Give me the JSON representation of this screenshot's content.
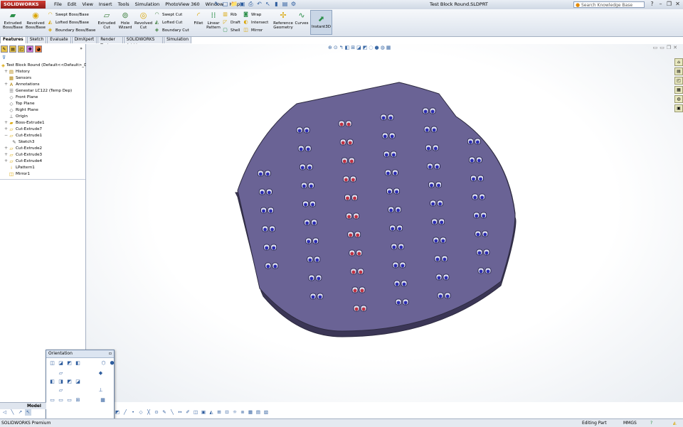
{
  "app": {
    "logo": "SOLIDWORKS",
    "title": "Test Block Round.SLDPRT",
    "search_placeholder": "Search Knowledge Base"
  },
  "menu": [
    "File",
    "Edit",
    "View",
    "Insert",
    "Tools",
    "Simulation",
    "PhotoView 360",
    "Window",
    "Help"
  ],
  "ribbon": {
    "extruded_boss": "Extruded Boss/Base",
    "revolved_boss": "Revolved Boss/Base",
    "swept_boss": "Swept Boss/Base",
    "lofted_boss": "Lofted Boss/Base",
    "boundary_boss": "Boundary Boss/Base",
    "extruded_cut": "Extruded Cut",
    "hole_wizard": "Hole Wizard",
    "revolved_cut": "Revolved Cut",
    "swept_cut": "Swept Cut",
    "lofted_cut": "Lofted Cut",
    "boundary_cut": "Boundary Cut",
    "fillet": "Fillet",
    "linear_pattern": "Linear Pattern",
    "rib": "Rib",
    "draft": "Draft",
    "shell": "Shell",
    "wrap": "Wrap",
    "intersect": "Intersect",
    "mirror": "Mirror",
    "reference_geometry": "Reference Geometry",
    "curves": "Curves",
    "instant3d": "Instant3D"
  },
  "tabs": [
    "Features",
    "Sketch",
    "Evaluate",
    "DimXpert",
    "Render Tools",
    "SOLIDWORKS Add-Ins",
    "Simulation"
  ],
  "tree": [
    {
      "label": "Test Block Round  (Default<<Default>_D",
      "icon": "part-icon",
      "indent": 0,
      "expand": ""
    },
    {
      "label": "History",
      "icon": "history-icon",
      "indent": 1,
      "expand": "+"
    },
    {
      "label": "Sensors",
      "icon": "sensor-icon",
      "indent": 1,
      "expand": ""
    },
    {
      "label": "Annotations",
      "icon": "annotation-icon",
      "indent": 1,
      "expand": "+"
    },
    {
      "label": "Genestar LC122 (Temp Dep)",
      "icon": "material-icon",
      "indent": 1,
      "expand": ""
    },
    {
      "label": "Front Plane",
      "icon": "plane-icon",
      "indent": 1,
      "expand": ""
    },
    {
      "label": "Top Plane",
      "icon": "plane-icon",
      "indent": 1,
      "expand": ""
    },
    {
      "label": "Right Plane",
      "icon": "plane-icon",
      "indent": 1,
      "expand": ""
    },
    {
      "label": "Origin",
      "icon": "origin-icon",
      "indent": 1,
      "expand": ""
    },
    {
      "label": "Boss-Extrude1",
      "icon": "extrude-icon",
      "indent": 1,
      "expand": "+"
    },
    {
      "label": "Cut-Extrude7",
      "icon": "cut-icon",
      "indent": 1,
      "expand": "+"
    },
    {
      "label": "Cut-Extrude1",
      "icon": "cut-icon",
      "indent": 1,
      "expand": "−"
    },
    {
      "label": "Sketch3",
      "icon": "sketch-icon",
      "indent": 2,
      "expand": ""
    },
    {
      "label": "Cut-Extrude2",
      "icon": "cut-icon",
      "indent": 1,
      "expand": "+"
    },
    {
      "label": "Cut-Extrude3",
      "icon": "cut-icon",
      "indent": 1,
      "expand": "+"
    },
    {
      "label": "Cut-Extrude4",
      "icon": "cut-icon",
      "indent": 1,
      "expand": "+"
    },
    {
      "label": "LPattern1",
      "icon": "pattern-icon",
      "indent": 1,
      "expand": ""
    },
    {
      "label": "Mirror1",
      "icon": "mirror-icon",
      "indent": 1,
      "expand": ""
    }
  ],
  "orientation": {
    "title": "Orientation"
  },
  "bottom": {
    "model_tab": "Model"
  },
  "status": {
    "left": "SOLIDWORKS Premium",
    "mode": "Editing Part",
    "units": "MMGS",
    "help": "?"
  },
  "colors": {
    "part_fill": "#6a6395",
    "part_edge": "#2d2a40",
    "hole_blue": "#2a2ab0",
    "hole_red": "#c03040"
  }
}
